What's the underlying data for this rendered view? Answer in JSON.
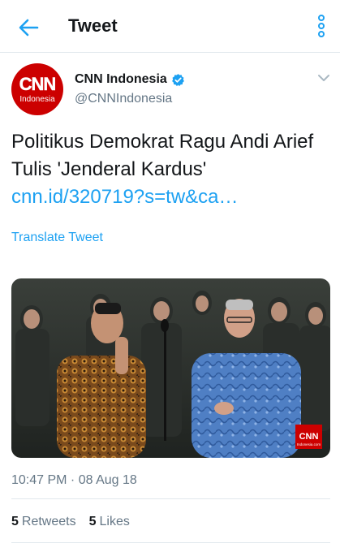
{
  "header": {
    "title": "Tweet",
    "back_icon": "arrow-left-icon",
    "menu_icon": "overflow-vertical-icon"
  },
  "author": {
    "name": "CNN Indonesia",
    "handle": "@CNNIndonesia",
    "avatar_logo": "CNN",
    "avatar_sub": "Indonesia",
    "verified_icon": "verified-badge-icon"
  },
  "tweet": {
    "text": "Politikus Demokrat Ragu Andi Arief Tulis 'Jenderal Kardus'",
    "link": "cnn.id/320719?s=tw&ca…",
    "translate_label": "Translate Tweet",
    "media_badge": "CNN",
    "media_badge_sub": "Indonesia.com",
    "timestamp": "10:47 PM · 08 Aug 18"
  },
  "stats": {
    "retweets_count": "5",
    "retweets_label": "Retweets",
    "likes_count": "5",
    "likes_label": "Likes"
  },
  "colors": {
    "accent": "#1da1f2",
    "brand_red": "#cc0000",
    "text_primary": "#14171a",
    "text_secondary": "#657786",
    "divider": "#e1e8ed"
  }
}
